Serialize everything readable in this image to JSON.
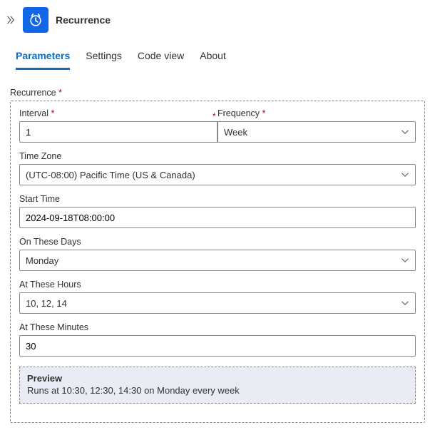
{
  "header": {
    "title": "Recurrence"
  },
  "tabs": {
    "parameters": "Parameters",
    "settings": "Settings",
    "codeview": "Code view",
    "about": "About"
  },
  "section": {
    "title": "Recurrence"
  },
  "fields": {
    "interval": {
      "label": "Interval",
      "value": "1"
    },
    "frequency": {
      "label": "Frequency",
      "value": "Week"
    },
    "timezone": {
      "label": "Time Zone",
      "value": "(UTC-08:00) Pacific Time (US & Canada)"
    },
    "starttime": {
      "label": "Start Time",
      "value": "2024-09-18T08:00:00"
    },
    "days": {
      "label": "On These Days",
      "value": "Monday"
    },
    "hours": {
      "label": "At These Hours",
      "value": "10, 12, 14"
    },
    "minutes": {
      "label": "At These Minutes",
      "value": "30"
    }
  },
  "preview": {
    "title": "Preview",
    "text": "Runs at 10:30, 12:30, 14:30 on Monday every week"
  }
}
